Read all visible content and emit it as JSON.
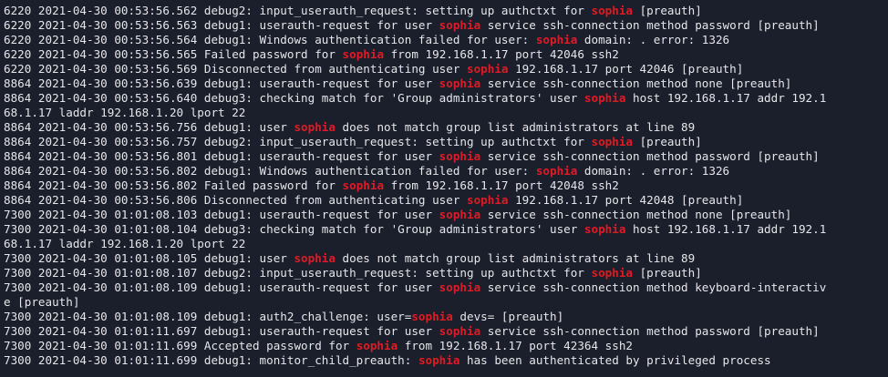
{
  "terminal": {
    "highlight_color": "#e01b24",
    "text_color": "#e6e6ea",
    "background_color": "#1b1e2b",
    "lines": [
      [
        "6220 2021-04-30 00:53:56.562 debug2: input_userauth_request: setting up authctxt for ",
        "sophia",
        " [preauth]"
      ],
      [
        "6220 2021-04-30 00:53:56.563 debug1: userauth-request for user ",
        "sophia",
        " service ssh-connection method password [preauth]"
      ],
      [
        "6220 2021-04-30 00:53:56.564 debug1: Windows authentication failed for user: ",
        "sophia",
        " domain: . error: 1326"
      ],
      [
        "6220 2021-04-30 00:53:56.565 Failed password for ",
        "sophia",
        " from 192.168.1.17 port 42046 ssh2"
      ],
      [
        "6220 2021-04-30 00:53:56.569 Disconnected from authenticating user ",
        "sophia",
        " 192.168.1.17 port 42046 [preauth]"
      ],
      [
        "8864 2021-04-30 00:53:56.639 debug1: userauth-request for user ",
        "sophia",
        " service ssh-connection method none [preauth]"
      ],
      [
        "8864 2021-04-30 00:53:56.640 debug3: checking match for 'Group administrators' user ",
        "sophia",
        " host 192.168.1.17 addr 192.1"
      ],
      [
        "68.1.17 laddr 192.168.1.20 lport 22"
      ],
      [
        "8864 2021-04-30 00:53:56.756 debug1: user ",
        "sophia",
        " does not match group list administrators at line 89"
      ],
      [
        "8864 2021-04-30 00:53:56.757 debug2: input_userauth_request: setting up authctxt for ",
        "sophia",
        " [preauth]"
      ],
      [
        "8864 2021-04-30 00:53:56.801 debug1: userauth-request for user ",
        "sophia",
        " service ssh-connection method password [preauth]"
      ],
      [
        "8864 2021-04-30 00:53:56.802 debug1: Windows authentication failed for user: ",
        "sophia",
        " domain: . error: 1326"
      ],
      [
        "8864 2021-04-30 00:53:56.802 Failed password for ",
        "sophia",
        " from 192.168.1.17 port 42048 ssh2"
      ],
      [
        "8864 2021-04-30 00:53:56.806 Disconnected from authenticating user ",
        "sophia",
        " 192.168.1.17 port 42048 [preauth]"
      ],
      [
        "7300 2021-04-30 01:01:08.103 debug1: userauth-request for user ",
        "sophia",
        " service ssh-connection method none [preauth]"
      ],
      [
        "7300 2021-04-30 01:01:08.104 debug3: checking match for 'Group administrators' user ",
        "sophia",
        " host 192.168.1.17 addr 192.1"
      ],
      [
        "68.1.17 laddr 192.168.1.20 lport 22"
      ],
      [
        "7300 2021-04-30 01:01:08.105 debug1: user ",
        "sophia",
        " does not match group list administrators at line 89"
      ],
      [
        "7300 2021-04-30 01:01:08.107 debug2: input_userauth_request: setting up authctxt for ",
        "sophia",
        " [preauth]"
      ],
      [
        "7300 2021-04-30 01:01:08.109 debug1: userauth-request for user ",
        "sophia",
        " service ssh-connection method keyboard-interactiv"
      ],
      [
        "e [preauth]"
      ],
      [
        "7300 2021-04-30 01:01:08.109 debug1: auth2_challenge: user=",
        "sophia",
        " devs= [preauth]"
      ],
      [
        "7300 2021-04-30 01:01:11.697 debug1: userauth-request for user ",
        "sophia",
        " service ssh-connection method password [preauth]"
      ],
      [
        "7300 2021-04-30 01:01:11.699 Accepted password for ",
        "sophia",
        " from 192.168.1.17 port 42364 ssh2"
      ],
      [
        "7300 2021-04-30 01:01:11.699 debug1: monitor_child_preauth: ",
        "sophia",
        " has been authenticated by privileged process"
      ]
    ]
  }
}
